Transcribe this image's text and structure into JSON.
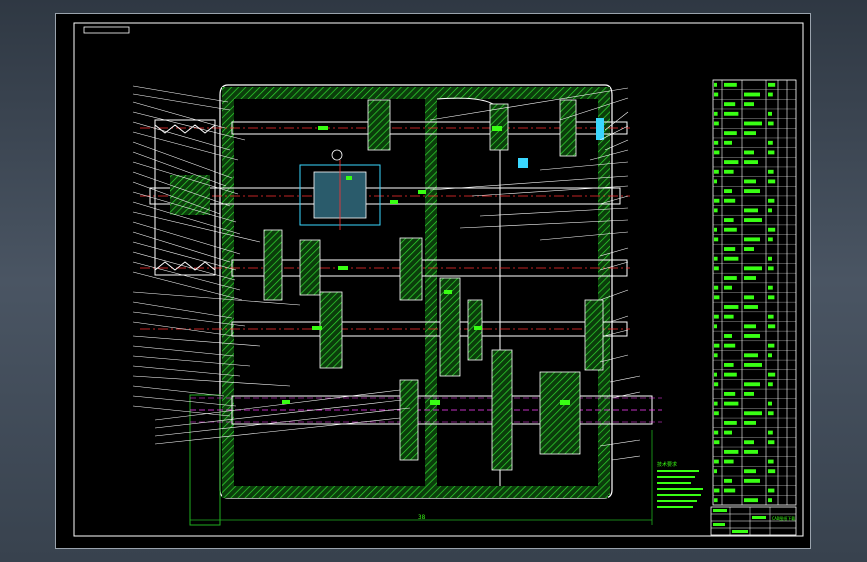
{
  "drawing": {
    "overall_dimension": "38",
    "technical_notes": [
      "技术要求"
    ],
    "title_block_text": "CAD图纸下载"
  },
  "parts_table": {
    "row_count": 44
  },
  "colors": {
    "background": "#000000",
    "outline": "#ffffff",
    "section_fill": "#1fae1f",
    "bright_green": "#39ff14",
    "centerline": "#ff3030",
    "hidden_line": "#ff40ff",
    "accent_cyan": "#3ad7ff",
    "viewport": "#3b4450"
  }
}
